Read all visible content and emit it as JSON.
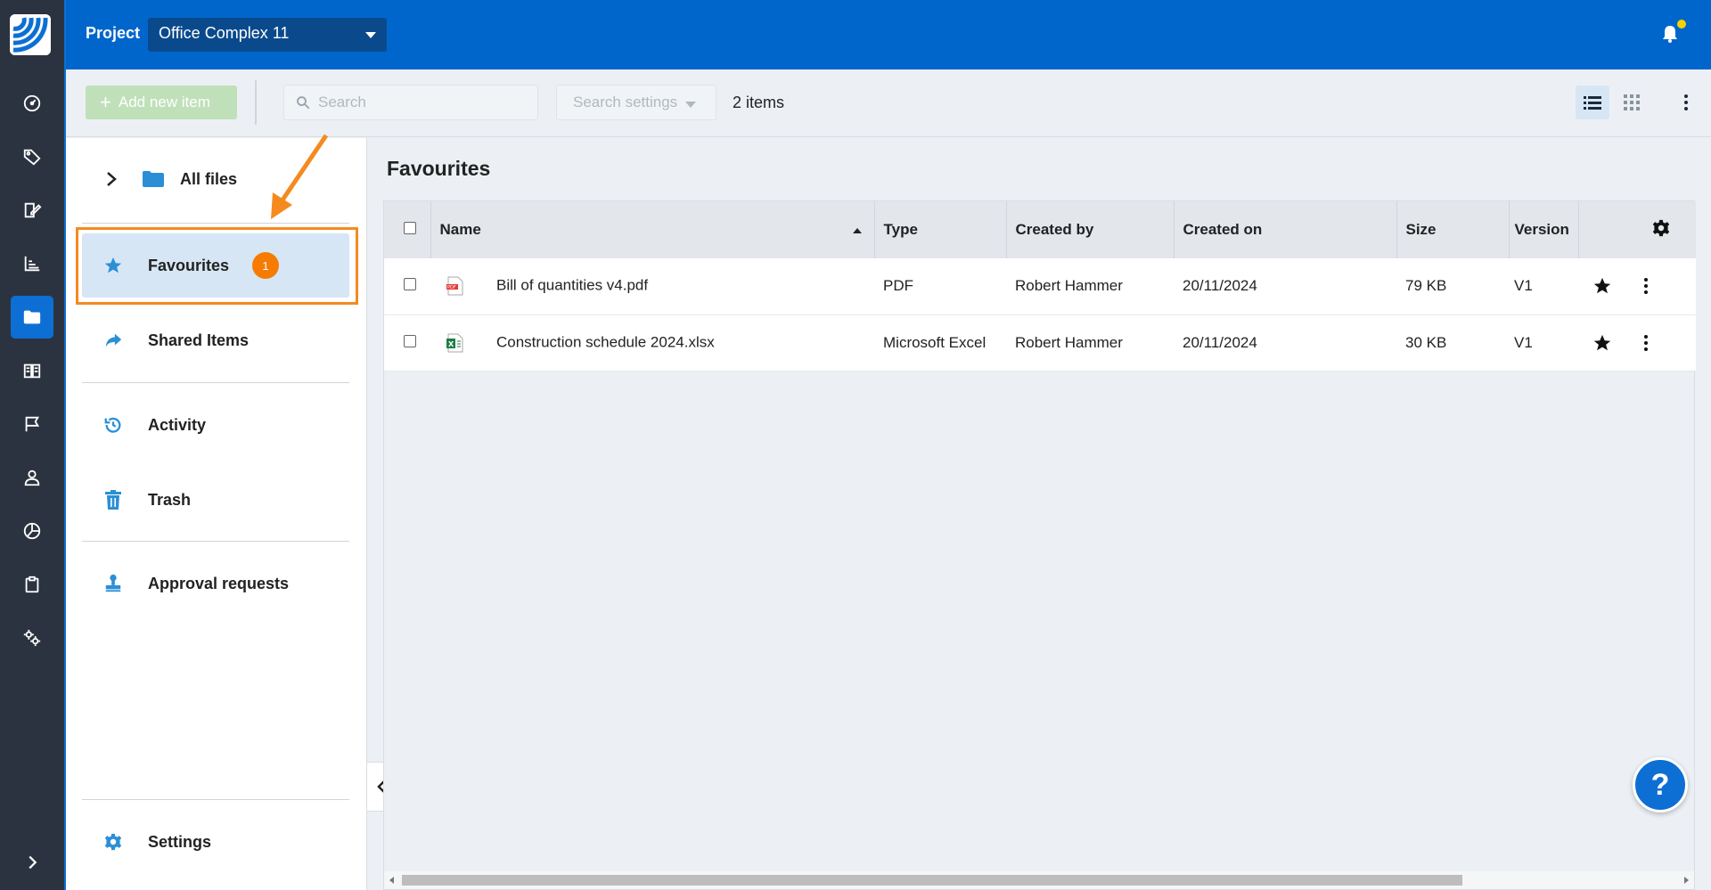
{
  "topbar": {
    "project_label": "Project",
    "project_name": "Office Complex 11"
  },
  "toolbar": {
    "add_label": "Add new item",
    "search_placeholder": "Search",
    "search_settings_label": "Search settings",
    "item_count": "2 items"
  },
  "rail": {
    "icons": [
      "dashboard-icon",
      "tag-icon",
      "edit-document-icon",
      "chart-icon",
      "folder-icon",
      "documents-icon",
      "flag-icon",
      "user-icon",
      "pie-chart-icon",
      "clipboard-icon",
      "settings-gears-icon"
    ],
    "active": "folder-icon"
  },
  "sidenav": {
    "all_files": "All files",
    "favourites": "Favourites",
    "favourites_badge": "1",
    "shared": "Shared Items",
    "activity": "Activity",
    "trash": "Trash",
    "approval": "Approval requests",
    "settings": "Settings"
  },
  "main": {
    "title": "Favourites",
    "columns": [
      "Name",
      "Type",
      "Created by",
      "Created on",
      "Size",
      "Version"
    ],
    "rows": [
      {
        "name": "Bill of quantities v4.pdf",
        "type": "PDF",
        "created_by": "Robert Hammer",
        "created_on": "20/11/2024",
        "size": "79 KB",
        "version": "V1",
        "file_icon": "pdf-icon"
      },
      {
        "name": "Construction schedule 2024.xlsx",
        "type": "Microsoft Excel",
        "created_by": "Robert Hammer",
        "created_on": "20/11/2024",
        "size": "30 KB",
        "version": "V1",
        "file_icon": "excel-icon"
      }
    ]
  },
  "help_label": "?",
  "colors": {
    "brand_blue": "#0066cc",
    "accent_orange": "#f57c00",
    "rail_bg": "#2b3340"
  }
}
